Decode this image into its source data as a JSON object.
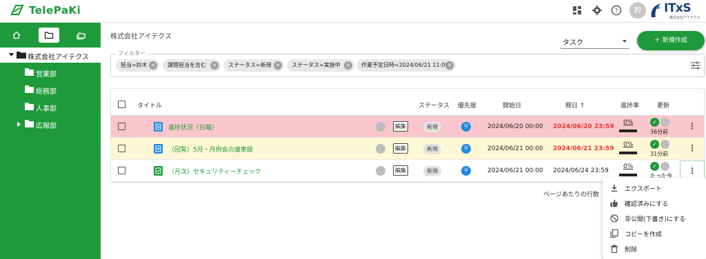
{
  "app": {
    "name": "TelePaKi"
  },
  "header": {
    "avatar_text": "鈴",
    "brand_name": "ITxS",
    "brand_sub": "株式会社アイテクス"
  },
  "sidebar": {
    "root": {
      "label": "株式会社アイテクス"
    },
    "items": [
      {
        "label": "営業部"
      },
      {
        "label": "総務部"
      },
      {
        "label": "人事部"
      },
      {
        "label": "広報部"
      }
    ]
  },
  "main": {
    "breadcrumb": "株式会社アイテクス",
    "type_select": {
      "value": "タスク"
    },
    "new_button": "＋ 新規作成",
    "filter": {
      "legend": "フィルター",
      "chips": [
        {
          "label": "担当=鈴木"
        },
        {
          "label": "課題担当を含む"
        },
        {
          "label": "ステータス=新規"
        },
        {
          "label": "ステータス=実施中"
        },
        {
          "label": "作業予定日時=2024/06/21 11:09"
        }
      ]
    },
    "table": {
      "headers": {
        "title": "タイトル",
        "status": "ステータス",
        "priority": "優先度",
        "start": "開始日",
        "due": "期日 ↑",
        "progress": "進捗率",
        "updated": "更新"
      },
      "rows": [
        {
          "title": "進捗状況（日報）",
          "edit": "編集",
          "status": "新規",
          "priority": "中",
          "start": "2024/06/20 00:00",
          "due": "2024/06/20 23:59",
          "progress": "0%",
          "progress_fraction": 0,
          "updated": "36分前",
          "bg": "#f8c6cc",
          "icon_color": "#1e88e5"
        },
        {
          "title": "（回覧）5月・月例会の議事録",
          "edit": "編集",
          "status": "新規",
          "priority": "中",
          "start": "2024/06/21 00:00",
          "due": "2024/06/21 23:59",
          "progress": "0%",
          "progress_fraction": 0,
          "updated": "31分前",
          "bg": "#fdf7d5",
          "icon_color": "#1e88e5"
        },
        {
          "title": "（月次）セキュリティーチェック",
          "edit": "編集",
          "status": "新規",
          "priority": "中",
          "start": "2024/06/21 00:00",
          "due": "2024/06/24 23:59",
          "progress": "0%",
          "progress_fraction": 0,
          "updated": "たった今",
          "bg": "#ffffff",
          "icon_color": "#1e9a3a"
        }
      ]
    },
    "rows_per_page": "ページあたりの行数"
  },
  "context_menu": {
    "items": [
      {
        "label": "エクスポート",
        "icon": "download-icon"
      },
      {
        "label": "確認済みにする",
        "icon": "thumbs-up-icon"
      },
      {
        "label": "非公開(下書き)にする",
        "icon": "block-icon"
      },
      {
        "label": "コピーを作成",
        "icon": "copy-icon"
      },
      {
        "label": "削除",
        "icon": "trash-icon"
      }
    ]
  },
  "colors": {
    "brand_green": "#1e9a3a",
    "overdue_red": "#e53935",
    "priority_blue": "#1e88e5"
  }
}
